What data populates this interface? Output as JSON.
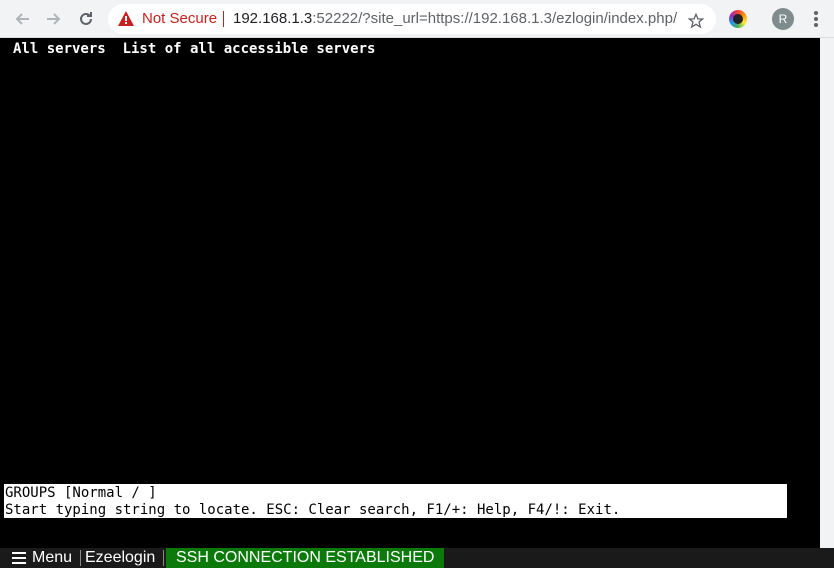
{
  "browser": {
    "security_label": "Not Secure",
    "url_host": "192.168.1.3",
    "url_rest": ":52222/?site_url=https://192.168.1.3/ezlogin/index.php/",
    "avatar_letter": "R",
    "icons": [
      "back-arrow-icon",
      "forward-arrow-icon",
      "reload-icon",
      "warning-icon",
      "star-icon",
      "extension-icon",
      "kebab-menu-icon"
    ]
  },
  "terminal": {
    "header": "All servers  List of all accessible servers",
    "status_line1": "GROUPS [Normal / ]",
    "status_line2": "Start typing string to locate. ESC: Clear search, F1/+: Help, F4/!: Exit."
  },
  "bottombar": {
    "menu_label": "Menu",
    "app_label": "Ezeelogin",
    "connection_status": "SSH CONNECTION ESTABLISHED"
  },
  "colors": {
    "warning": "#c5221f",
    "connection_ok": "#0b7a0b"
  }
}
